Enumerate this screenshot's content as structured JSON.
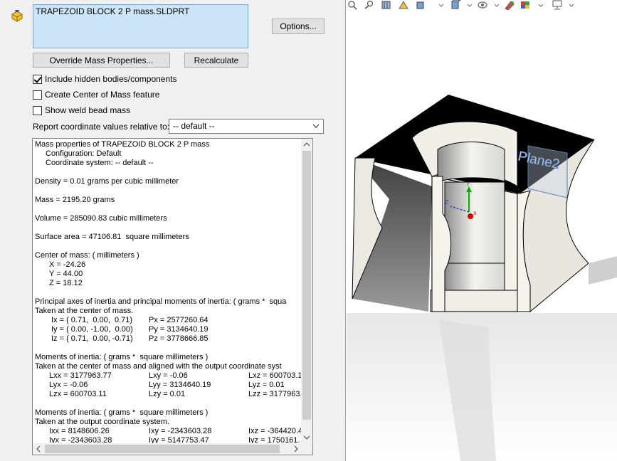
{
  "dialog": {
    "selection_text": "TRAPEZOID BLOCK 2 P mass.SLDPRT",
    "options_label": "Options...",
    "override_label": "Override Mass Properties...",
    "recalculate_label": "Recalculate",
    "checkboxes": [
      {
        "label": "Include hidden bodies/components",
        "checked": true
      },
      {
        "label": "Create Center of Mass feature",
        "checked": false
      },
      {
        "label": "Show weld bead mass",
        "checked": false
      }
    ],
    "coord_label": "Report coordinate values relative to:",
    "coord_value": "-- default --"
  },
  "results": {
    "title": "Mass properties of TRAPEZOID BLOCK 2 P mass",
    "configuration": "Configuration: Default",
    "coord_system": "Coordinate system: -- default --",
    "density": "Density = 0.01 grams per cubic millimeter",
    "mass": "Mass = 2195.20 grams",
    "volume": "Volume = 285090.83 cubic millimeters",
    "surface_area": "Surface area = 47106.81  square millimeters",
    "com_header": "Center of mass: ( millimeters )",
    "com_x": "X = -24.26",
    "com_y": "Y = 44.00",
    "com_z": "Z = 18.12",
    "principal_header": "Principal axes of inertia and principal moments of inertia: ( grams *  squa",
    "principal_taken": "Taken at the center of mass.",
    "ix": "Ix = ( 0.71,  0.00,  0.71)",
    "iy": "Iy = ( 0.00, -1.00,  0.00)",
    "iz": "Iz = ( 0.71,  0.00, -0.71)",
    "px": "Px = 2577260.64",
    "py": "Py = 3134640.19",
    "pz": "Pz = 3778666.85",
    "moi_header": "Moments of inertia: ( grams *  square millimeters )",
    "moi_taken": "Taken at the center of mass and aligned with the output coordinate syst",
    "lxx": "Lxx = 3177963.77",
    "lxy": "Lxy = -0.06",
    "lxz": "Lxz = 600703.1",
    "lyx": "Lyx = -0.06",
    "lyy": "Lyy = 3134640.19",
    "lyz": "Lyz = 0.01",
    "lzx": "Lzx = 600703.11",
    "lzy": "Lzy = 0.01",
    "lzz": "Lzz = 3177963.",
    "moi2_header": "Moments of inertia: ( grams *  square millimeters )",
    "moi2_taken": "Taken at the output coordinate system.",
    "ixx": "Ixx = 8148606.26",
    "ixy": "Ixy = -2343603.28",
    "ixz": "Ixz = -364420.4",
    "iyx": "Iyx = -2343603.28",
    "iyy": "Iyy = 5147753.47",
    "iyz": "Iyz = 1750161."
  },
  "viewport": {
    "plane_label": "Plane2",
    "axis_x": "X",
    "axis_y": "Y",
    "axis_z": "Z"
  },
  "colors": {
    "selection_bg": "#cce4f7",
    "panel_bg": "#f0f0f0",
    "axis_x": "#d40000",
    "axis_y": "#00b000",
    "axis_z": "#2040d0"
  }
}
